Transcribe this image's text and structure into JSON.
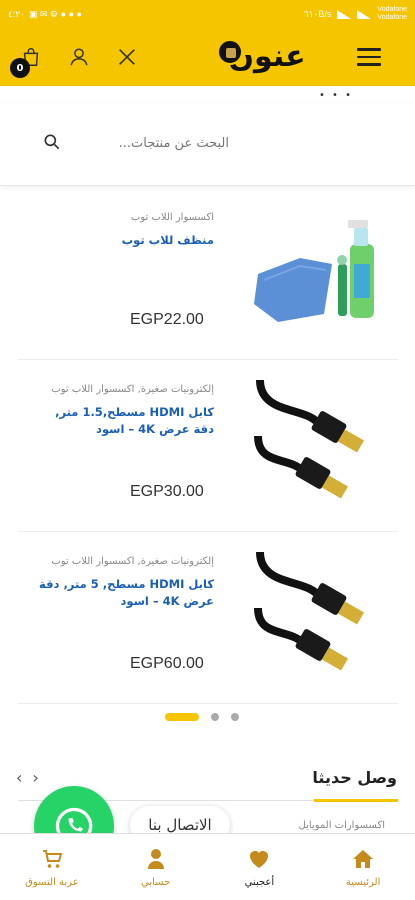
{
  "status_bar": {
    "time": "٤:٢٠",
    "network_speed": "٦١٠B/s",
    "carrier_1": "Vodafone",
    "carrier_2": "Vodafone"
  },
  "header": {
    "logo_text": "عنون",
    "cart_count": "0"
  },
  "search": {
    "placeholder": "البحث عن منتجات..."
  },
  "products": [
    {
      "category": "اكسسوار اللاب توب",
      "title": "منظف للاب توب",
      "price": "EGP22.00"
    },
    {
      "category": "إلكترونيات صغيرة, اكسسوار اللاب توب",
      "title": "كابل HDMI مسطح,1.5 متر, دقة عرض 4K – اسود",
      "price": "EGP30.00"
    },
    {
      "category": "إلكترونيات صغيرة, اكسسوار اللاب توب",
      "title": "كابل HDMI مسطح, 5 متر, دقة عرض 4K – اسود",
      "price": "EGP60.00"
    }
  ],
  "carousel": {
    "active_index": 0,
    "count": 3
  },
  "latest": {
    "title": "وصل حديثا",
    "category": "اكسسوارات الموبايل"
  },
  "contact": {
    "label": "الاتصال بنا"
  },
  "bottom_nav": [
    {
      "label": "الرئيسية",
      "icon": "home-icon"
    },
    {
      "label": "أعجبني",
      "icon": "heart-icon"
    },
    {
      "label": "حسابي",
      "icon": "person-icon"
    },
    {
      "label": "عربة التسوق",
      "icon": "cart-icon"
    }
  ],
  "colors": {
    "brand_yellow": "#f5c500",
    "link_blue": "#1a5fb4",
    "nav_gold": "#c48a1c",
    "whatsapp_green": "#25d366"
  }
}
